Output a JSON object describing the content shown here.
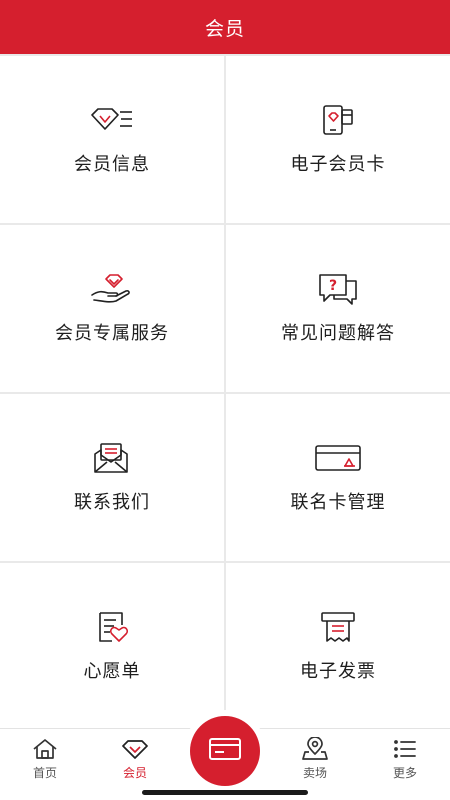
{
  "header": {
    "title": "会员"
  },
  "menu": [
    {
      "label": "会员信息",
      "icon": "diamond-list-icon"
    },
    {
      "label": "电子会员卡",
      "icon": "phone-card-icon"
    },
    {
      "label": "会员专属服务",
      "icon": "hand-diamond-icon"
    },
    {
      "label": "常见问题解答",
      "icon": "question-chat-icon"
    },
    {
      "label": "联系我们",
      "icon": "envelope-icon"
    },
    {
      "label": "联名卡管理",
      "icon": "credit-card-icon"
    },
    {
      "label": "心愿单",
      "icon": "wishlist-heart-icon"
    },
    {
      "label": "电子发票",
      "icon": "invoice-receipt-icon"
    }
  ],
  "tabbar": {
    "items": [
      {
        "label": "首页",
        "icon": "home-icon",
        "active": false
      },
      {
        "label": "会员",
        "icon": "diamond-icon",
        "active": true
      },
      {
        "label": "卖场",
        "icon": "map-pin-icon",
        "active": false
      },
      {
        "label": "更多",
        "icon": "more-list-icon",
        "active": false
      }
    ],
    "center_button_icon": "card-icon"
  },
  "colors": {
    "accent": "#d51f2e",
    "divider": "#e9e9e9"
  }
}
